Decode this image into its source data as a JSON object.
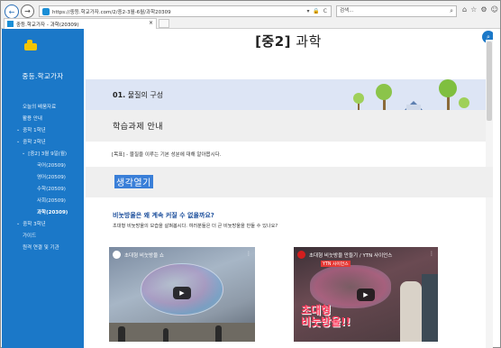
{
  "browser": {
    "url": "https://중등.학교가자.com/2/중2-3월-6월/과학20309",
    "search_placeholder": "검색...",
    "tab_title": "중등.학교가자 - 과학(20309)",
    "address_controls": "▾ 🔒 C"
  },
  "sidebar": {
    "site_title": "중등.학교가자",
    "items": [
      {
        "label": "오늘의 배움자료",
        "caret": ""
      },
      {
        "label": "활용 안내",
        "caret": ""
      },
      {
        "label": "중학 1학년",
        "caret": "⌄"
      },
      {
        "label": "중학 2학년",
        "caret": "⌄"
      },
      {
        "label": "[중2] 3월 9일(월)",
        "caret": "⌄"
      },
      {
        "label": "국어(20509)",
        "caret": ""
      },
      {
        "label": "영어(20509)",
        "caret": ""
      },
      {
        "label": "수학(20509)",
        "caret": ""
      },
      {
        "label": "사회(20509)",
        "caret": ""
      },
      {
        "label": "과학(20309)",
        "caret": ""
      },
      {
        "label": "중학 3학년",
        "caret": "⌄"
      },
      {
        "label": "가이드",
        "caret": ""
      },
      {
        "label": "원격 연결 및 기관",
        "caret": ""
      }
    ]
  },
  "main": {
    "title_prefix": "[중2]",
    "title_subject": " 과학",
    "unit": {
      "number": "01.",
      "name": " 물질의 구성"
    },
    "task_heading": "학습과제 안내",
    "objective": "[목표] - 물질을 이루는 기본 성분에 대해 알아봅시다.",
    "think_label": "생각열기",
    "question": "비눗방울은 왜 계속 커질 수 없을까요?",
    "question_sub": "초대형 비눗방울의 모습을 살펴봅시다. 여러분들은 더 큰 비눗방울을 만들 수 있나요?",
    "videos": [
      {
        "title": "초대형 비눗방울 쇼"
      },
      {
        "title": "초대형 비눗방울 만들기 / YTN 사이언스",
        "tag": "YTN 사이언스",
        "overlay_line1": "초대형",
        "overlay_line2": "비눗방울!!"
      }
    ]
  },
  "colors": {
    "sidebar_bg": "#1b78c8",
    "band_unit": "#dde5f5",
    "band_gray": "#efefef",
    "highlight": "#3a7fd8",
    "question_text": "#1c4f9c"
  }
}
